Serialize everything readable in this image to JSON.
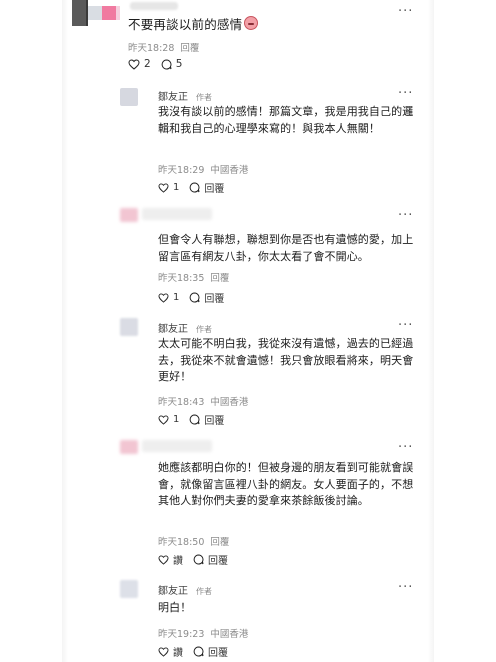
{
  "top_comment": {
    "text": "不要再談以前的感情",
    "time": "昨天18:28",
    "reply": "回覆",
    "likes": "2",
    "replies": "5"
  },
  "replies": [
    {
      "author": "鄒友正",
      "author_tag": "作者",
      "text": "我沒有談以前的感情！那篇文章，我是用我自己的邏輯和我自己的心理學來寫的！與我本人無關！",
      "time": "昨天18:29",
      "location": "中國香港",
      "likes": "1",
      "reply": "回覆"
    },
    {
      "author": "",
      "author_tag": "",
      "text": "但會令人有聯想，聯想到你是否也有遺憾的愛，加上留言區有網友八卦，你太太看了會不開心。",
      "time": "昨天18:35",
      "location": "",
      "likes": "1",
      "reply": "回覆"
    },
    {
      "author": "鄒友正",
      "author_tag": "作者",
      "text": "太太可能不明白我，我從來沒有遺憾，過去的已經過去，我從來不就會遺憾！我只會放眼看將來，明天會更好！",
      "time": "昨天18:43",
      "location": "中國香港",
      "likes": "1",
      "reply": "回覆"
    },
    {
      "author": "",
      "author_tag": "",
      "text": "她應該都明白你的！但被身邊的朋友看到可能就會誤會，就像留言區裡八卦的網友。女人要面子的，不想其他人對你們夫妻的愛拿來茶餘飯後討論。",
      "time": "昨天18:50",
      "location": "",
      "likes": "讚",
      "reply": "回覆"
    },
    {
      "author": "鄒友正",
      "author_tag": "作者",
      "text": "明白！",
      "time": "昨天19:23",
      "location": "中國香港",
      "likes": "讚",
      "reply": "回覆"
    }
  ],
  "icons": {
    "like": "heart-icon",
    "reply": "speech-bubble-icon",
    "more": "more-dots-icon"
  }
}
